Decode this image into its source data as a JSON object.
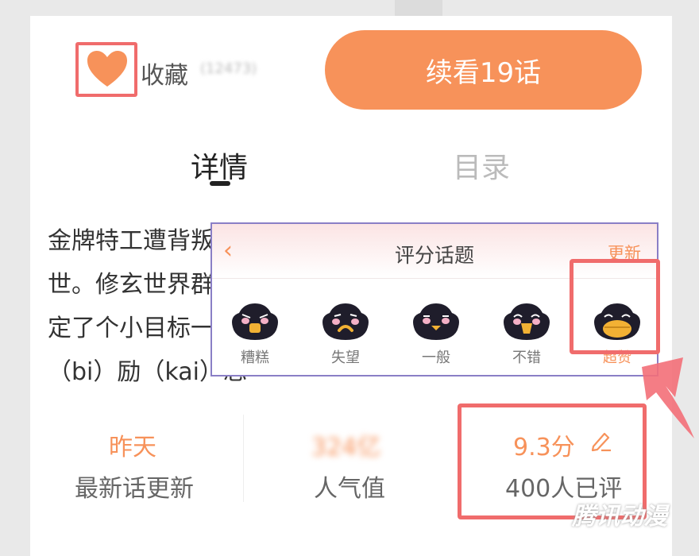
{
  "favorite": {
    "label": "收藏",
    "count": "(12473)"
  },
  "continue_button": {
    "label": "续看19话"
  },
  "tabs": [
    {
      "label": "详情"
    },
    {
      "label": "目录"
    }
  ],
  "description": {
    "lines": [
      "金牌特工遭背叛",
      "世。修玄世界群",
      "定了个小目标一",
      "（bi）励（kai）忘"
    ]
  },
  "stats": {
    "update": {
      "value": "昨天",
      "label": "最新话更新"
    },
    "popularity": {
      "value": "324亿",
      "label": "人气值"
    },
    "score": {
      "value": "9.3分",
      "label": "400人已评"
    }
  },
  "rating_popup": {
    "title": "评分话题",
    "refresh": "更新",
    "options": [
      {
        "label": "糟糕",
        "icon": "penguin-bad-icon"
      },
      {
        "label": "失望",
        "icon": "penguin-disappointed-icon"
      },
      {
        "label": "一般",
        "icon": "penguin-ok-icon"
      },
      {
        "label": "不错",
        "icon": "penguin-good-icon"
      },
      {
        "label": "超赞",
        "icon": "penguin-great-icon"
      }
    ]
  },
  "watermark": "腾讯动漫",
  "colors": {
    "accent": "#f7925a",
    "highlight": "#f06c6c",
    "popup_border": "#8a7fc6"
  }
}
